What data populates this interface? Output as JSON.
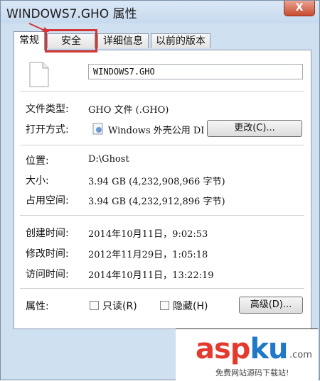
{
  "window": {
    "title": "WINDOWS7.GHO 属性",
    "close_label": "X"
  },
  "tabs": [
    {
      "label": "常规",
      "active": true
    },
    {
      "label": "安全",
      "active": false
    },
    {
      "label": "详细信息",
      "active": false
    },
    {
      "label": "以前的版本",
      "active": false
    }
  ],
  "general": {
    "file_name": "WINDOWS7.GHO",
    "file_type_label": "文件类型:",
    "file_type_value": "GHO 文件 (.GHO)",
    "open_with_label": "打开方式:",
    "open_with_value": "Windows 外壳公用 DI",
    "change_button": "更改(C)...",
    "location_label": "位置:",
    "location_value": "D:\\Ghost",
    "size_label": "大小:",
    "size_value": "3.94 GB (4,232,908,966 字节)",
    "size_on_disk_label": "占用空间:",
    "size_on_disk_value": "3.94 GB (4,232,912,896 字节)",
    "created_label": "创建时间:",
    "created_value": "2014年10月11日，9:02:53",
    "modified_label": "修改时间:",
    "modified_value": "2012年11月29日，1:05:18",
    "accessed_label": "访问时间:",
    "accessed_value": "2014年10月11日，13:22:19",
    "attributes_label": "属性:",
    "readonly_label": "只读(R)",
    "hidden_label": "隐藏(H)",
    "advanced_button": "高级(D)..."
  },
  "watermark": {
    "logo_asp": "asp",
    "logo_ku": "ku",
    "logo_com": ".com",
    "subtitle": "免费网站源码下载站!"
  },
  "colors": {
    "highlight": "#d43535",
    "window_frame": "#cfe0f1"
  }
}
